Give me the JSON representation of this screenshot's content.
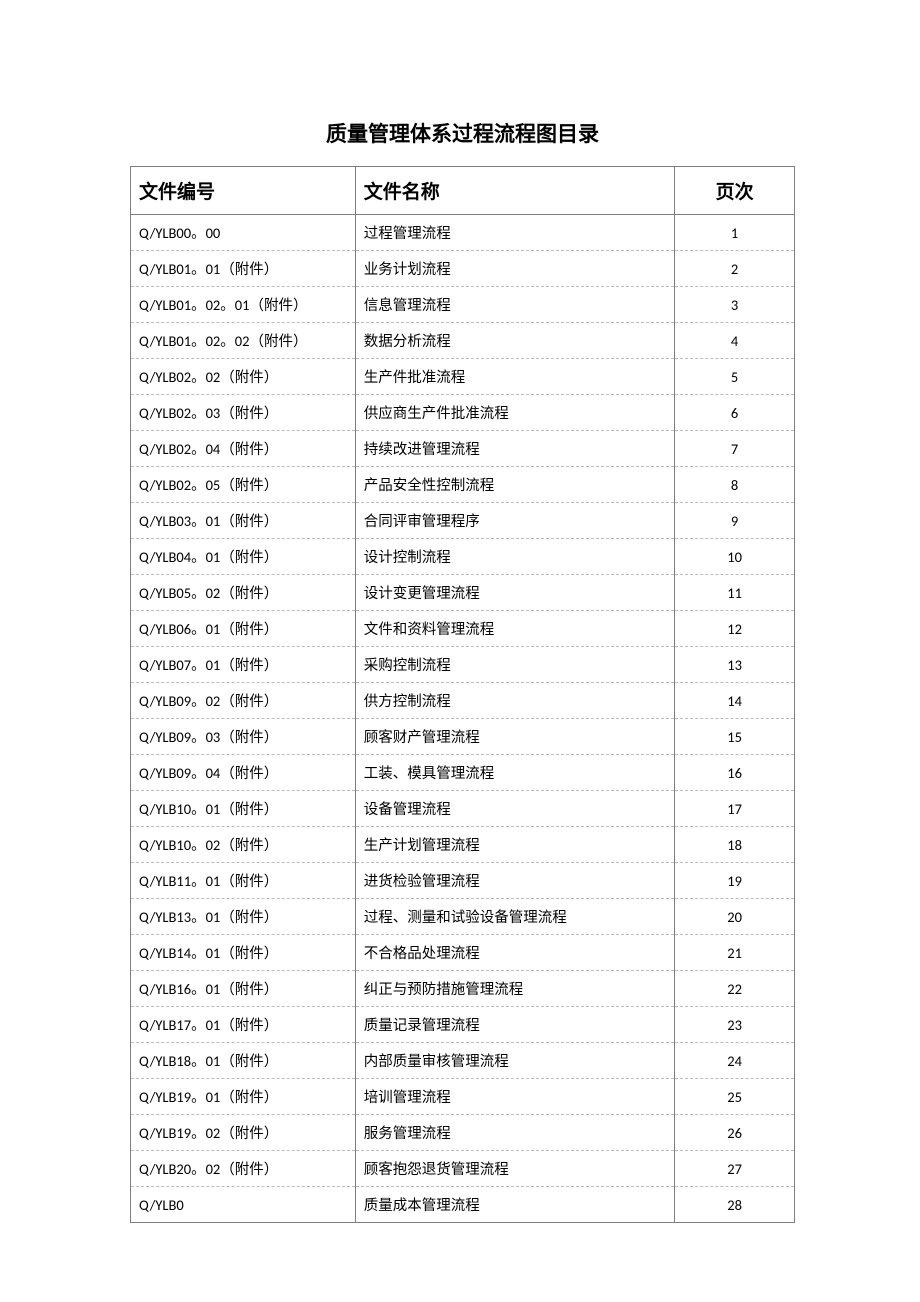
{
  "title": "质量管理体系过程流程图目录",
  "headers": {
    "code": "文件编号",
    "name": "文件名称",
    "page": "页次"
  },
  "rows": [
    {
      "code": "Q/YLB00。00",
      "name": "过程管理流程",
      "page": "1"
    },
    {
      "code": "Q/YLB01。01（附件）",
      "name": "业务计划流程",
      "page": "2"
    },
    {
      "code": "Q/YLB01。02。01（附件）",
      "name": "信息管理流程",
      "page": "3"
    },
    {
      "code": "Q/YLB01。02。02（附件）",
      "name": "数据分析流程",
      "page": "4"
    },
    {
      "code": "Q/YLB02。02（附件）",
      "name": "生产件批准流程",
      "page": "5"
    },
    {
      "code": "Q/YLB02。03（附件）",
      "name": "供应商生产件批准流程",
      "page": "6"
    },
    {
      "code": "Q/YLB02。04（附件）",
      "name": "持续改进管理流程",
      "page": "7"
    },
    {
      "code": "Q/YLB02。05（附件）",
      "name": "产品安全性控制流程",
      "page": "8"
    },
    {
      "code": "Q/YLB03。01（附件）",
      "name": "合同评审管理程序",
      "page": "9"
    },
    {
      "code": "Q/YLB04。01（附件）",
      "name": "设计控制流程",
      "page": "10"
    },
    {
      "code": "Q/YLB05。02（附件）",
      "name": "设计变更管理流程",
      "page": "11"
    },
    {
      "code": "Q/YLB06。01（附件）",
      "name": "文件和资料管理流程",
      "page": "12"
    },
    {
      "code": "Q/YLB07。01（附件）",
      "name": "采购控制流程",
      "page": "13"
    },
    {
      "code": "Q/YLB09。02（附件）",
      "name": "供方控制流程",
      "page": "14"
    },
    {
      "code": "Q/YLB09。03（附件）",
      "name": "顾客财产管理流程",
      "page": "15"
    },
    {
      "code": "Q/YLB09。04（附件）",
      "name": "工装、模具管理流程",
      "page": "16"
    },
    {
      "code": "Q/YLB10。01（附件）",
      "name": "设备管理流程",
      "page": "17"
    },
    {
      "code": "Q/YLB10。02（附件）",
      "name": "生产计划管理流程",
      "page": "18"
    },
    {
      "code": "Q/YLB11。01（附件）",
      "name": "进货检验管理流程",
      "page": "19"
    },
    {
      "code": "Q/YLB13。01（附件）",
      "name": "过程、测量和试验设备管理流程",
      "page": "20"
    },
    {
      "code": "Q/YLB14。01（附件）",
      "name": "不合格品处理流程",
      "page": "21"
    },
    {
      "code": "Q/YLB16。01（附件）",
      "name": "纠正与预防措施管理流程",
      "page": "22"
    },
    {
      "code": "Q/YLB17。01（附件）",
      "name": "质量记录管理流程",
      "page": "23"
    },
    {
      "code": "Q/YLB18。01（附件）",
      "name": "内部质量审核管理流程",
      "page": "24"
    },
    {
      "code": "Q/YLB19。01（附件）",
      "name": "培训管理流程",
      "page": "25"
    },
    {
      "code": "Q/YLB19。02（附件）",
      "name": "服务管理流程",
      "page": "26"
    },
    {
      "code": "Q/YLB20。02（附件）",
      "name": "顾客抱怨退货管理流程",
      "page": "27"
    },
    {
      "code": "Q/YLB0",
      "name": "质量成本管理流程",
      "page": "28"
    }
  ]
}
